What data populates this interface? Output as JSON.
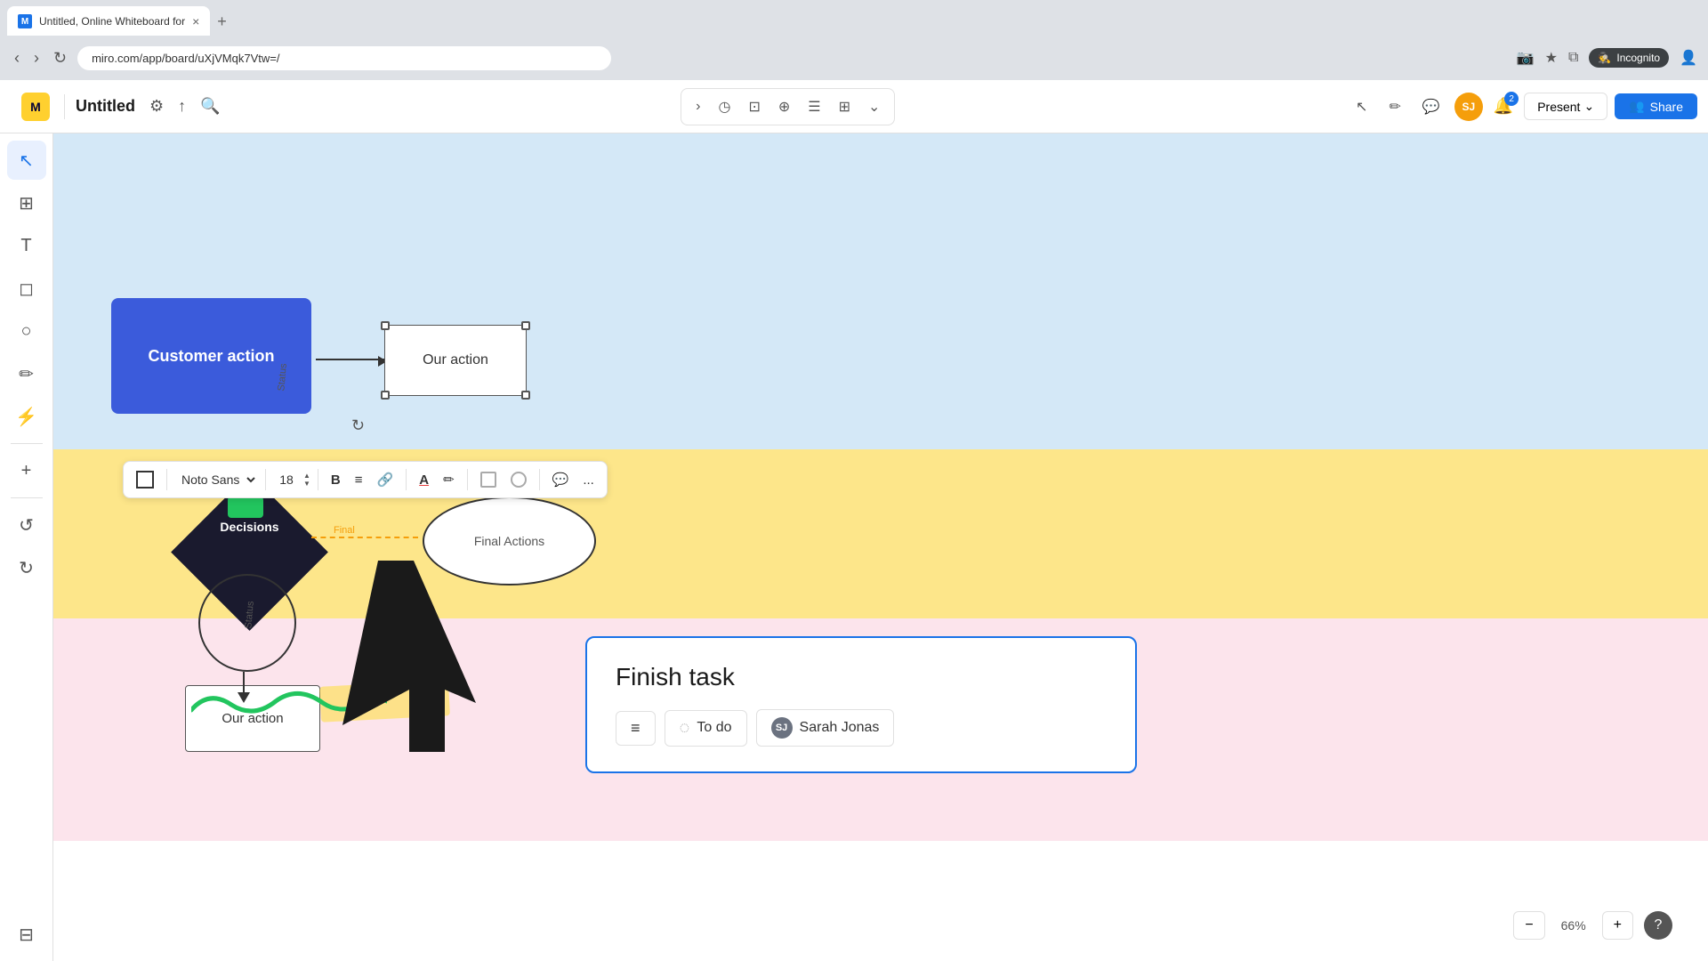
{
  "browser": {
    "tab_title": "Untitled, Online Whiteboard for",
    "url": "miro.com/app/board/uXjVMqk7Vtw=/",
    "new_tab_symbol": "+",
    "close_tab_symbol": "×",
    "incognito_label": "Incognito"
  },
  "header": {
    "logo_text": "miro",
    "board_title": "Untitled",
    "settings_icon": "⚙",
    "share_icon": "↑",
    "search_icon": "🔍",
    "present_label": "Present",
    "share_label": "Share",
    "notification_count": "2"
  },
  "toolbar_center": {
    "arrow_icon": "›",
    "timer_icon": "◷",
    "frame_icon": "⊡",
    "screenshot_icon": "⊕",
    "card_icon": "☰",
    "table_icon": "⊞",
    "more_icon": "⌄"
  },
  "left_sidebar": {
    "select_tool": "↖",
    "grid_tool": "⊞",
    "text_tool": "T",
    "sticky_tool": "◻",
    "shapes_tool": "○",
    "pen_tool": "✏",
    "connector_tool": "⚡",
    "plus_tool": "+",
    "undo_tool": "↺",
    "redo_tool": "↻",
    "panel_tool": "⊟"
  },
  "canvas": {
    "customer_action_label": "Customer action",
    "our_action_label": "Our action",
    "our_action_bottom_label": "Our action",
    "decisions_label": "Decisions",
    "final_actions_label": "Final Actions",
    "final_label_dashed": "Final",
    "status_label": "Status"
  },
  "format_toolbar": {
    "font_name": "Noto Sans",
    "font_size": "18",
    "bold_label": "B",
    "align_label": "≡",
    "link_label": "🔗",
    "color_label": "A",
    "highlight_label": "✏",
    "comment_icon": "💬",
    "more_icon": "..."
  },
  "finish_task_card": {
    "title": "Finish task",
    "menu_icon": "≡",
    "status_label": "To do",
    "status_icon": "◌",
    "assignee_label": "Sarah Jonas",
    "assignee_initials": "SJ"
  },
  "zoom": {
    "minus_label": "−",
    "level": "66%",
    "plus_label": "+",
    "help_label": "?"
  }
}
